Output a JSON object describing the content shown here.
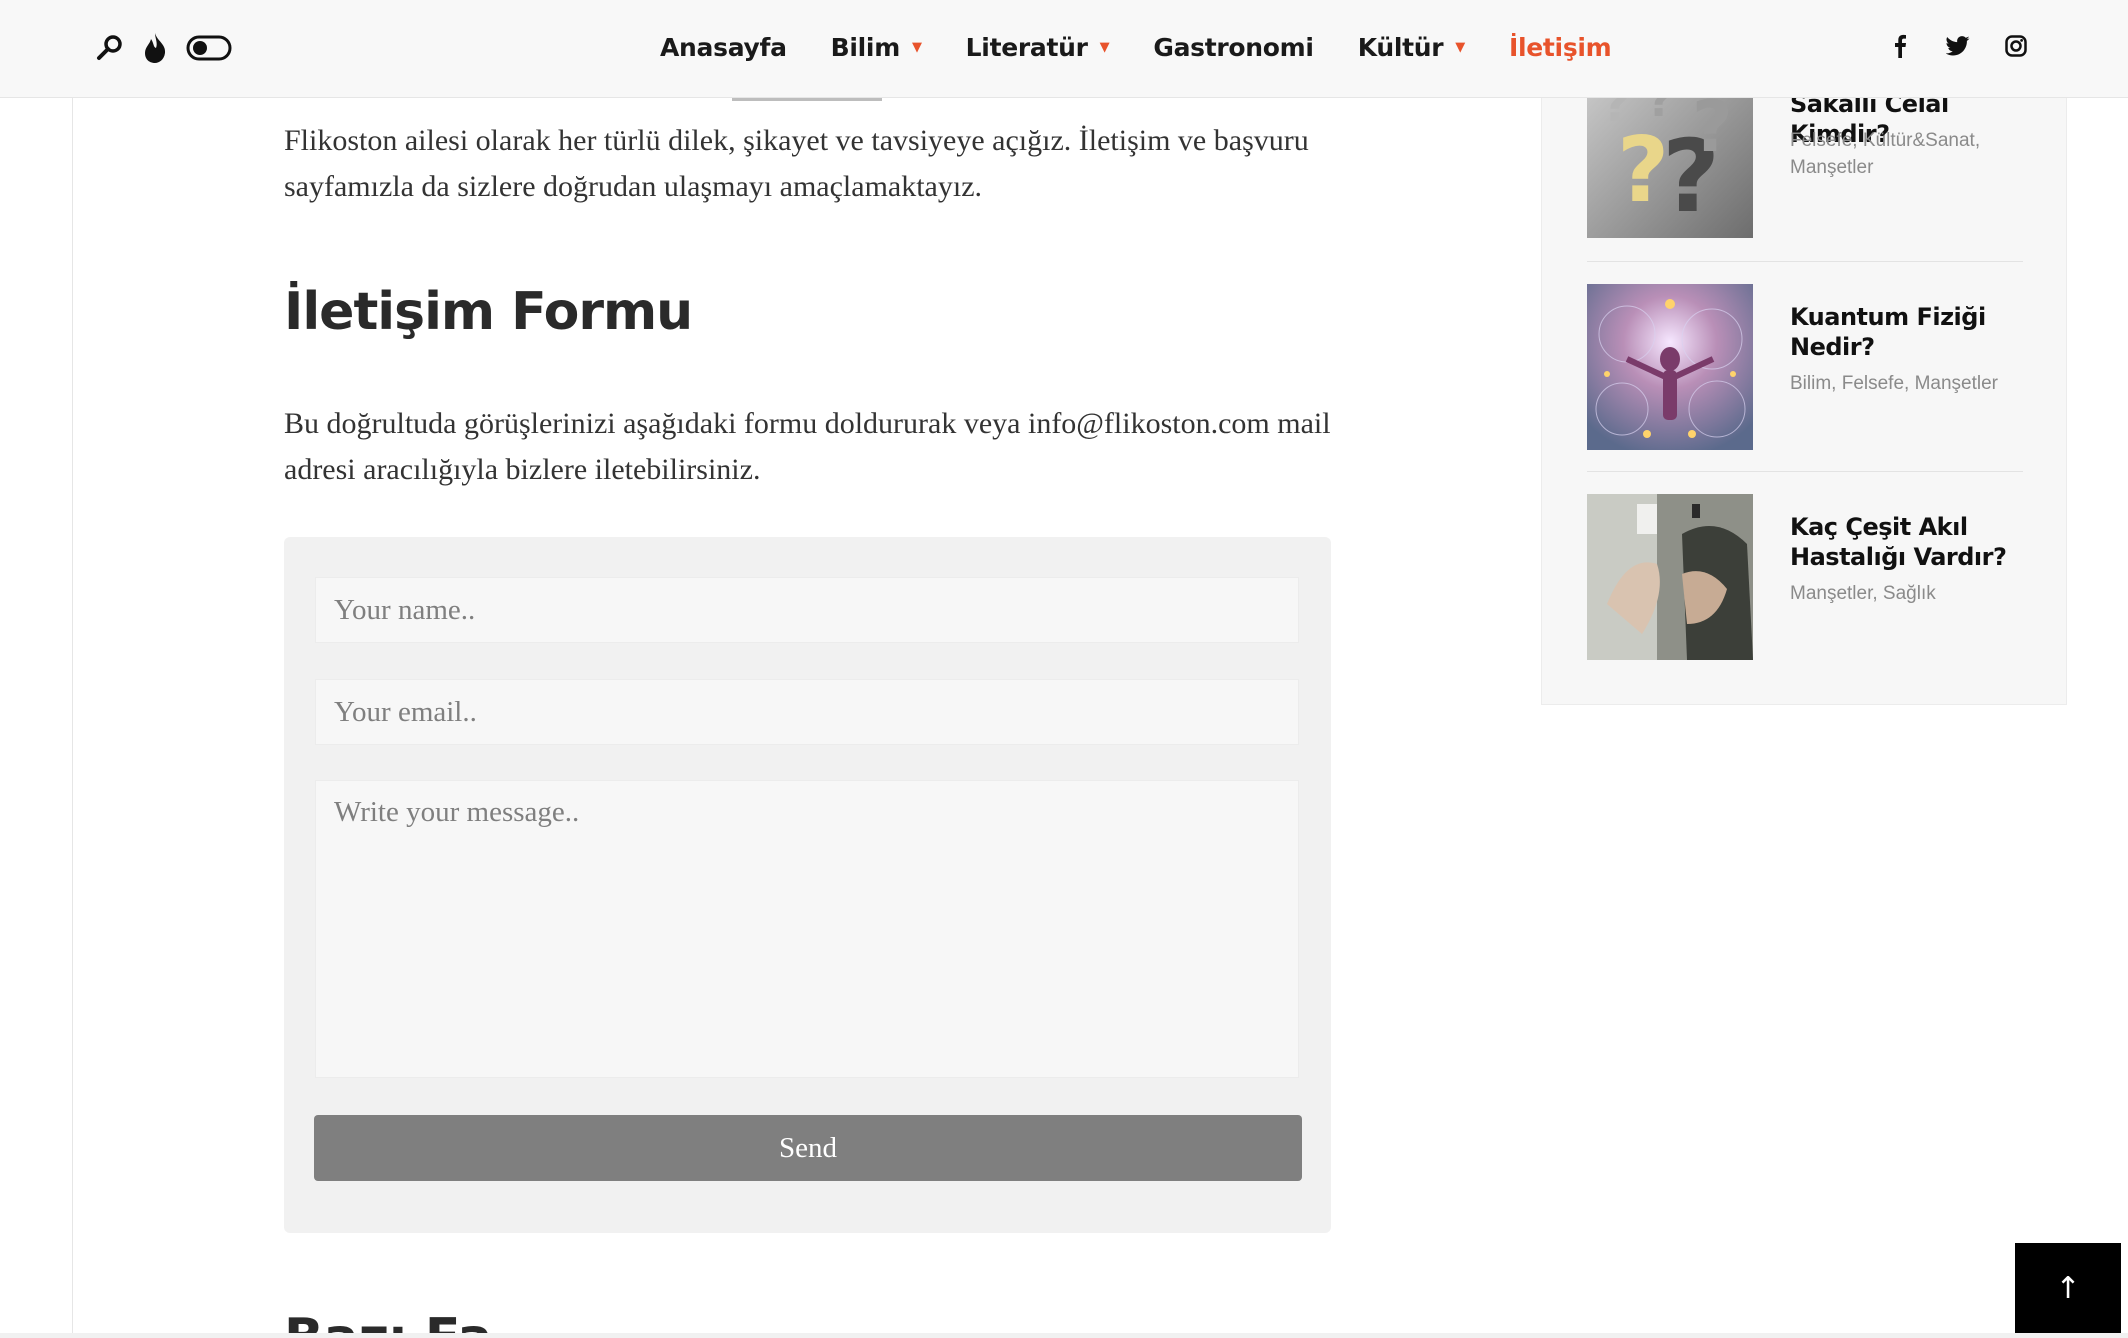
{
  "header": {
    "nav": [
      {
        "label": "Anasayfa",
        "dropdown": false,
        "active": false
      },
      {
        "label": "Bilim",
        "dropdown": true,
        "active": false
      },
      {
        "label": "Literatür",
        "dropdown": true,
        "active": false
      },
      {
        "label": "Gastronomi",
        "dropdown": false,
        "active": false
      },
      {
        "label": "Kültür",
        "dropdown": true,
        "active": false
      },
      {
        "label": "İletişim",
        "dropdown": false,
        "active": true
      }
    ],
    "caret_glyph": "▼",
    "left_icons": [
      "search-icon",
      "flame-icon",
      "dark-mode-toggle"
    ],
    "social_icons": [
      "facebook-icon",
      "twitter-icon",
      "instagram-icon"
    ],
    "accent_color": "#e8532b"
  },
  "main": {
    "intro": "Flikoston ailesi olarak her türlü dilek, şikayet ve tavsiyeye açığız. İletişim ve başvuru sayfamızla da sizlere doğrudan ulaşmayı amaçlamaktayız.",
    "form_heading": "İletişim Formu",
    "description": "Bu doğrultuda görüşlerinizi aşağıdaki formu doldururak veya info@flikoston.com mail adresi aracılığıyla bizlere iletebilirsiniz.",
    "form": {
      "name_placeholder": "Your name..",
      "email_placeholder": "Your email..",
      "message_placeholder": "Write your message..",
      "send_label": "Send"
    },
    "next_heading": "Bazı Fa"
  },
  "sidebar": {
    "posts": [
      {
        "title": "Sakallı Celal Kimdir?",
        "categories": "Felsefe, Kültür&Sanat, Manşetler"
      },
      {
        "title": "Kuantum Fiziği Nedir?",
        "categories": "Bilim, Felsefe, Manşetler"
      },
      {
        "title": "Kaç Çeşit Akıl Hastalığı Vardır?",
        "categories": "Manşetler, Sağlık"
      }
    ]
  },
  "back_to_top": {
    "label": "↑"
  }
}
